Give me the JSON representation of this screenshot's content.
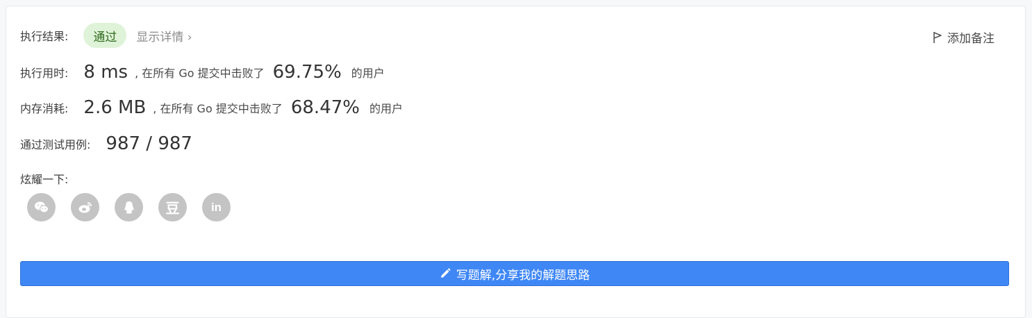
{
  "result": {
    "label": "执行结果:",
    "status": "通过",
    "details_link": "显示详情 ›"
  },
  "note": {
    "label": "添加备注"
  },
  "runtime": {
    "label": "执行用时:",
    "value": "8 ms",
    "middle": ", 在所有 Go 提交中击败了",
    "percent": "69.75%",
    "suffix": "的用户"
  },
  "memory": {
    "label": "内存消耗:",
    "value": "2.6 MB",
    "middle": ", 在所有 Go 提交中击败了",
    "percent": "68.47%",
    "suffix": "的用户"
  },
  "tests": {
    "label": "通过测试用例:",
    "value": "987 / 987"
  },
  "share": {
    "label": "炫耀一下:",
    "icons": [
      "wechat-icon",
      "weibo-icon",
      "qq-icon",
      "douban-icon",
      "linkedin-icon"
    ],
    "douban_glyph": "豆",
    "linkedin_glyph": "in"
  },
  "solution_button": {
    "label": "写题解,分享我的解题思路"
  },
  "colors": {
    "accent": "#3f87f5",
    "success_bg": "#dff3d8",
    "success_text": "#2f6b1f",
    "icon_gray": "#c4c4c4"
  }
}
